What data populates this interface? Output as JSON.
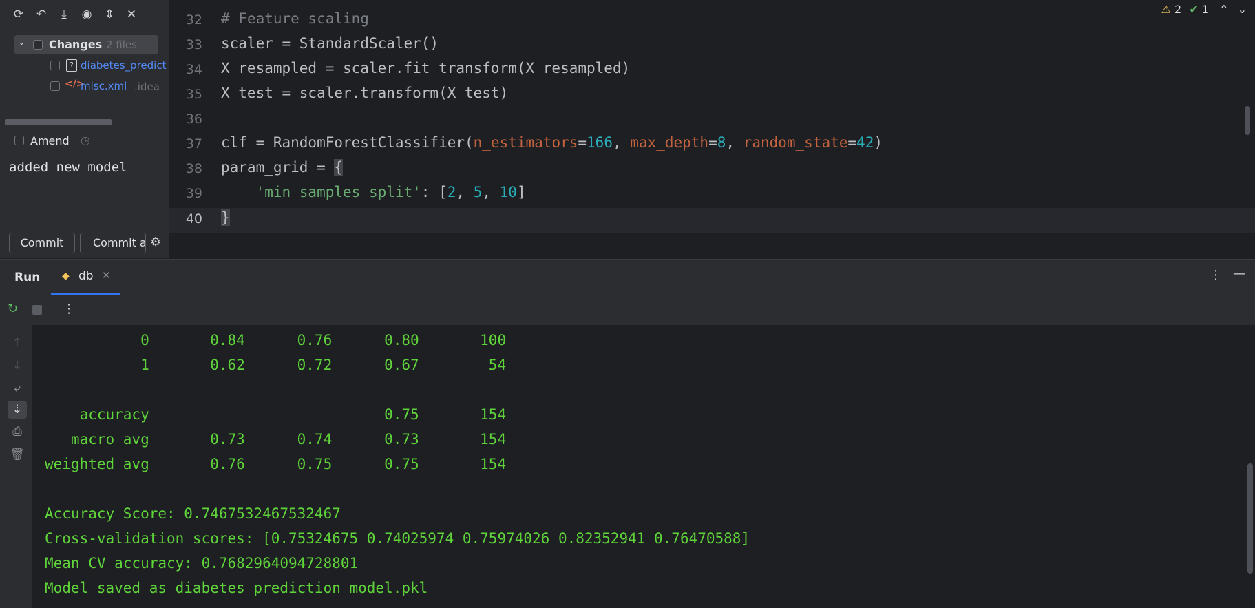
{
  "commit_panel": {
    "toolbar_icons": [
      "refresh-icon",
      "rollback-icon",
      "shelve-icon",
      "eye-icon",
      "expand-collapse-icon",
      "close-icon"
    ],
    "changes_label": "Changes",
    "changes_count": "2 files",
    "files": [
      {
        "name": "diabetes_predict",
        "dir": "",
        "icon": "question-file-icon",
        "color": "#548af7"
      },
      {
        "name": "misc.xml",
        "dir": ".idea",
        "icon": "xml-file-icon",
        "color": "#548af7"
      }
    ],
    "amend_label": "Amend",
    "commit_message": "added new model",
    "commit_button": "Commit",
    "commit_and_push_button": "Commit and Push..."
  },
  "editor": {
    "inspections": {
      "warnings": "2",
      "ok": "1"
    },
    "lines": [
      {
        "n": "32",
        "text": "# Feature scaling"
      },
      {
        "n": "33",
        "text": "scaler = StandardScaler()"
      },
      {
        "n": "34",
        "text": "X_resampled = scaler.fit_transform(X_resampled)"
      },
      {
        "n": "35",
        "text": "X_test = scaler.transform(X_test)"
      },
      {
        "n": "36",
        "text": ""
      },
      {
        "n": "37",
        "text": "clf = RandomForestClassifier(n_estimators=166, max_depth=8, random_state=42)"
      },
      {
        "n": "38",
        "text": "param_grid = {"
      },
      {
        "n": "39",
        "text": "    'min_samples_split': [2, 5, 10]"
      },
      {
        "n": "40",
        "text": "}"
      }
    ]
  },
  "run_window": {
    "title": "Run",
    "tab_label": "db",
    "output": [
      "           0       0.84      0.76      0.80       100",
      "           1       0.62      0.72      0.67        54",
      "",
      "    accuracy                           0.75       154",
      "   macro avg       0.73      0.74      0.73       154",
      "weighted avg       0.76      0.75      0.75       154",
      "",
      "Accuracy Score: 0.7467532467532467",
      "Cross-validation scores: [0.75324675 0.74025974 0.75974026 0.82352941 0.76470588]",
      "Mean CV accuracy: 0.7682964094728801",
      "Model saved as diabetes_prediction_model.pkl"
    ]
  },
  "colors": {
    "output_green": "#5fd43a",
    "accent_blue": "#3574f0"
  }
}
